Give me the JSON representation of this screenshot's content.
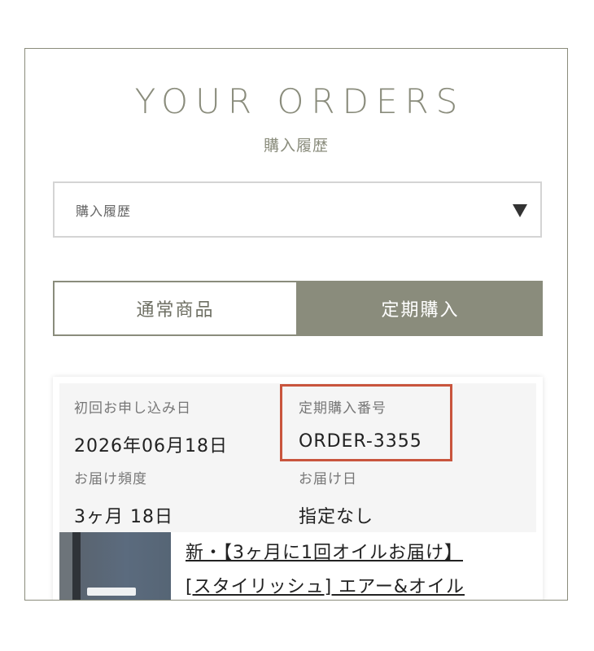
{
  "header": {
    "title": "YOUR ORDERS",
    "subtitle": "購入履歴"
  },
  "filter_select": {
    "value": "購入履歴",
    "caret_icon": "triangle-down-icon"
  },
  "tabs": [
    {
      "label": "通常商品",
      "active": false
    },
    {
      "label": "定期購入",
      "active": true
    }
  ],
  "order": {
    "first_order_date_label": "初回お申し込み日",
    "first_order_date": "2026年06月18日",
    "subscription_number_label": "定期購入番号",
    "subscription_number": "ORDER-3355",
    "frequency_label": "お届け頻度",
    "frequency": "3ヶ月 18日",
    "delivery_date_label": "お届け日",
    "delivery_date": "指定なし",
    "product_title_line1": "新・【3ヶ月に1回オイルお届け】",
    "product_title_line2": "[スタイリッシュ] エアー&オイル"
  },
  "colors": {
    "accent": "#8a8c7c",
    "highlight_border": "#c9553d",
    "info_background": "#f5f5f5"
  }
}
